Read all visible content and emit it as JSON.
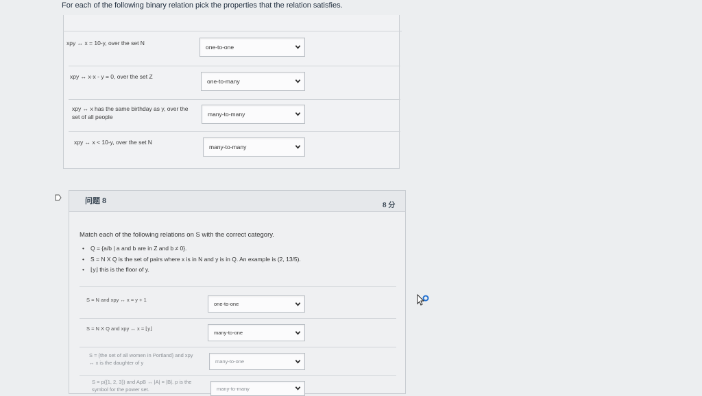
{
  "intro": "For each of the following binary relation pick the properties that the relation satisfies.",
  "relations1": [
    {
      "label": "xpy ↔ x = 10-y, over the set N",
      "selected": "one-to-one"
    },
    {
      "label": "xpy ↔ x·x - y = 0, over the set Z",
      "selected": "one-to-many"
    },
    {
      "label_line1": "xpy ↔ x has the same birthday as y, over the",
      "label_line2": "set of all people",
      "selected": "many-to-many"
    },
    {
      "label": "xpy ↔ x < 10-y, over the set N",
      "selected": "many-to-many"
    }
  ],
  "question": {
    "title": "问题 8",
    "points": "8 分",
    "prompt": "Match each of the following relations on S with the correct category.",
    "bullets": [
      "Q = {a/b | a and b are in Z and b ≠ 0}.",
      "S = N X Q is the set of pairs where x is in N and y is in Q. An example is (2, 13/5).",
      "⌊y⌋ this is the floor of y."
    ],
    "relations": [
      {
        "label": "S = N and xpy ↔ x = y + 1",
        "selected": "one-to-one"
      },
      {
        "label": "S = N X Q and xpy ↔ x = ⌊y⌋",
        "selected": "many-to-one"
      },
      {
        "label_line1": "S = {the set of all women in Portland} and xpy",
        "label_line2": "↔ x is the daughter of y",
        "selected": "many-to-one"
      },
      {
        "label_line1": "S = p({1, 2, 3}) and ApB ↔ |A| = |B|. p is the",
        "label_line2": "symbol for the power set.",
        "selected": "many-to-many"
      }
    ]
  }
}
